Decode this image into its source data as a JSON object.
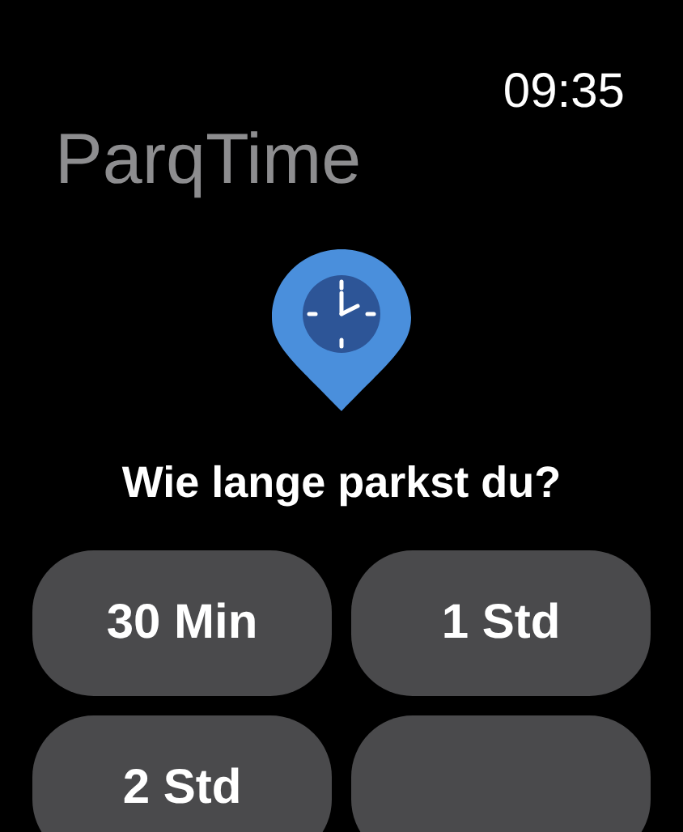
{
  "status_bar": {
    "time": "09:35"
  },
  "app": {
    "title": "ParqTime"
  },
  "prompt": "Wie lange parkst du?",
  "buttons": [
    {
      "kind": "option",
      "label": "30 Min"
    },
    {
      "kind": "option",
      "label": "1 Std"
    },
    {
      "kind": "option",
      "label": "2 Std"
    },
    {
      "kind": "option"
    }
  ]
}
